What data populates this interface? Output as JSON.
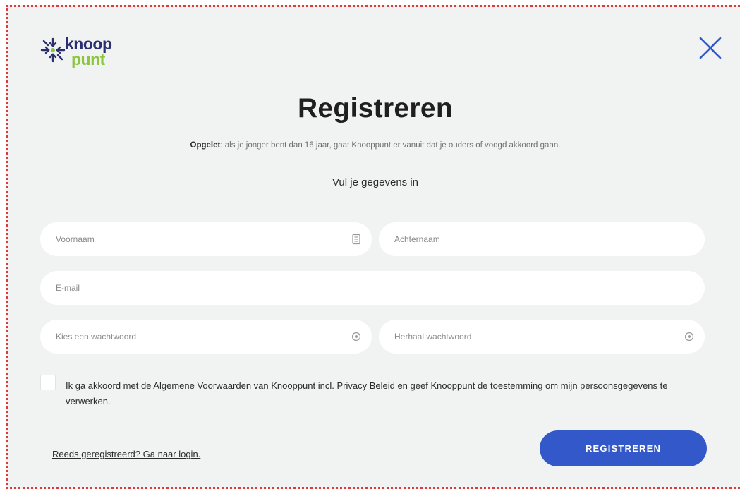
{
  "brand": {
    "line1": "knoop",
    "line2": "punt"
  },
  "dialog": {
    "title": "Registreren"
  },
  "notice": {
    "bold": "Opgelet",
    "text": ": als je jonger bent dan 16 jaar, gaat Knooppunt er vanuit dat je ouders of voogd akkoord gaan."
  },
  "section_label": "Vul je gegevens in",
  "form": {
    "first_name_placeholder": "Voornaam",
    "last_name_placeholder": "Achternaam",
    "email_placeholder": "E-mail",
    "password_placeholder": "Kies een wachtwoord",
    "password_repeat_placeholder": "Herhaal wachtwoord"
  },
  "consent": {
    "before": "Ik ga akkoord met de ",
    "link": "Algemene Voorwaarden van Knooppunt incl. Privacy Beleid",
    "after": " en geef Knooppunt de toestemming om mijn persoonsgegevens te verwerken.",
    "checked": false
  },
  "footer": {
    "login_link": "Reeds geregistreerd? Ga naar login.",
    "register_button": "REGISTREREN"
  },
  "icons": {
    "close": "close-icon",
    "first_name_field": "contact-card-icon",
    "password_field": "password-reveal-icon"
  },
  "colors": {
    "accent": "#3358c9",
    "brand_navy": "#2a2f70",
    "brand_green": "#8cc63f",
    "frame_border": "#e0393b",
    "background": "#f1f2f2"
  }
}
